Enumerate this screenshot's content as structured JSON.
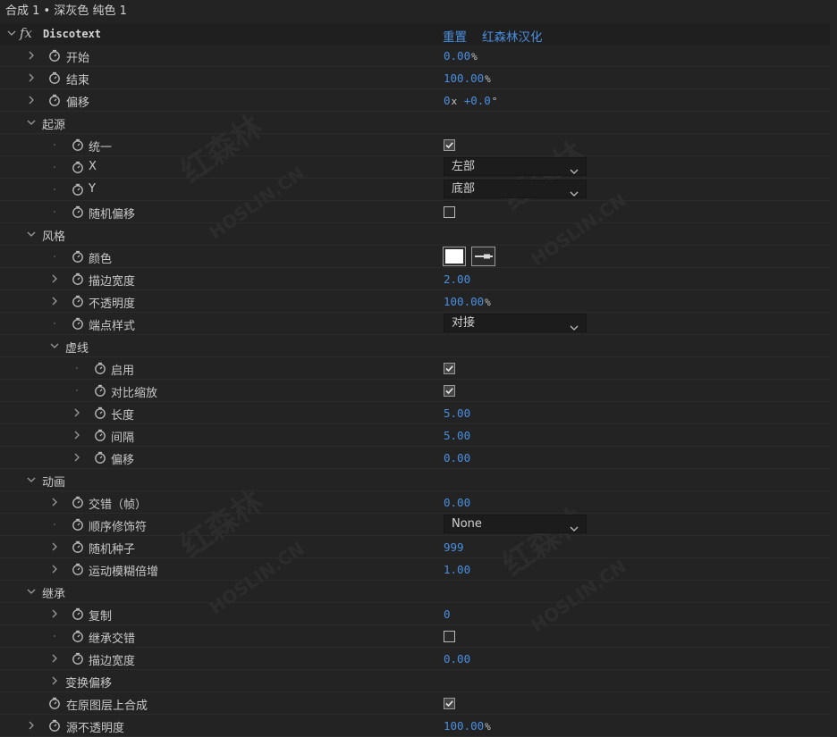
{
  "header": {
    "title": "合成 1 • 深灰色 纯色 1"
  },
  "effect": {
    "name": "Discotext",
    "reset_label": "重置",
    "about_label": "红森林汉化"
  },
  "watermark": {
    "cn": "红森林",
    "en": "HOSLIN.CN"
  },
  "colors": {
    "accent": "#4a8fe0",
    "bg": "#232323",
    "swatch": "#ffffff"
  },
  "rows": [
    {
      "indent": 0,
      "expander": "collapsed",
      "stopwatch": true,
      "label": "开始",
      "control": "number",
      "value": "0.00",
      "unit": "%"
    },
    {
      "indent": 0,
      "expander": "collapsed",
      "stopwatch": true,
      "label": "结束",
      "control": "number",
      "value": "100.00",
      "unit": "%"
    },
    {
      "indent": 0,
      "expander": "collapsed",
      "stopwatch": true,
      "label": "偏移",
      "control": "angle",
      "value": "0",
      "unit": "x",
      "value2": "+0.0",
      "unit2": "°"
    },
    {
      "indent": 0,
      "expander": "expanded",
      "stopwatch": false,
      "label": "起源",
      "control": "none"
    },
    {
      "indent": 1,
      "expander": "none",
      "stopwatch": true,
      "label": "统一",
      "control": "checkbox",
      "checked": true
    },
    {
      "indent": 1,
      "expander": "none",
      "stopwatch": true,
      "label": "X",
      "control": "select",
      "value": "左部"
    },
    {
      "indent": 1,
      "expander": "none",
      "stopwatch": true,
      "label": "Y",
      "control": "select",
      "value": "底部"
    },
    {
      "indent": 1,
      "expander": "none",
      "stopwatch": true,
      "label": "随机偏移",
      "control": "checkbox",
      "checked": false
    },
    {
      "indent": 0,
      "expander": "expanded",
      "stopwatch": false,
      "label": "风格",
      "control": "none"
    },
    {
      "indent": 1,
      "expander": "none",
      "stopwatch": true,
      "label": "颜色",
      "control": "color"
    },
    {
      "indent": 1,
      "expander": "collapsed",
      "stopwatch": true,
      "label": "描边宽度",
      "control": "number",
      "value": "2.00",
      "unit": ""
    },
    {
      "indent": 1,
      "expander": "collapsed",
      "stopwatch": true,
      "label": "不透明度",
      "control": "number",
      "value": "100.00",
      "unit": "%"
    },
    {
      "indent": 1,
      "expander": "none",
      "stopwatch": true,
      "label": "端点样式",
      "control": "select",
      "value": "对接"
    },
    {
      "indent": 1,
      "expander": "expanded",
      "stopwatch": false,
      "label": "虚线",
      "control": "none"
    },
    {
      "indent": 2,
      "expander": "none",
      "stopwatch": true,
      "label": "启用",
      "control": "checkbox",
      "checked": true
    },
    {
      "indent": 2,
      "expander": "none",
      "stopwatch": true,
      "label": "对比缩放",
      "control": "checkbox",
      "checked": true
    },
    {
      "indent": 2,
      "expander": "collapsed",
      "stopwatch": true,
      "label": "长度",
      "control": "number",
      "value": "5.00",
      "unit": ""
    },
    {
      "indent": 2,
      "expander": "collapsed",
      "stopwatch": true,
      "label": "间隔",
      "control": "number",
      "value": "5.00",
      "unit": ""
    },
    {
      "indent": 2,
      "expander": "collapsed",
      "stopwatch": true,
      "label": "偏移",
      "control": "number",
      "value": "0.00",
      "unit": ""
    },
    {
      "indent": 0,
      "expander": "expanded",
      "stopwatch": false,
      "label": "动画",
      "control": "none"
    },
    {
      "indent": 1,
      "expander": "collapsed",
      "stopwatch": true,
      "label": "交错（帧）",
      "control": "number",
      "value": "0.00",
      "unit": ""
    },
    {
      "indent": 1,
      "expander": "none",
      "stopwatch": true,
      "label": "顺序修饰符",
      "control": "select",
      "value": "None"
    },
    {
      "indent": 1,
      "expander": "collapsed",
      "stopwatch": true,
      "label": "随机种子",
      "control": "number",
      "value": "999",
      "unit": ""
    },
    {
      "indent": 1,
      "expander": "collapsed",
      "stopwatch": true,
      "label": "运动模糊倍增",
      "control": "number",
      "value": "1.00",
      "unit": ""
    },
    {
      "indent": 0,
      "expander": "expanded",
      "stopwatch": false,
      "label": "继承",
      "control": "none"
    },
    {
      "indent": 1,
      "expander": "collapsed",
      "stopwatch": true,
      "label": "复制",
      "control": "number",
      "value": "0",
      "unit": ""
    },
    {
      "indent": 1,
      "expander": "none",
      "stopwatch": true,
      "label": "继承交错",
      "control": "checkbox",
      "checked": false
    },
    {
      "indent": 1,
      "expander": "collapsed",
      "stopwatch": true,
      "label": "描边宽度",
      "control": "number",
      "value": "0.00",
      "unit": ""
    },
    {
      "indent": 1,
      "expander": "collapsed",
      "stopwatch": false,
      "label": "变换偏移",
      "control": "none"
    },
    {
      "indent": 0,
      "expander": "none",
      "stopwatch": true,
      "label": "在原图层上合成",
      "control": "checkbox",
      "checked": true
    },
    {
      "indent": 0,
      "expander": "collapsed",
      "stopwatch": true,
      "label": "源不透明度",
      "control": "number",
      "value": "100.00",
      "unit": "%"
    }
  ]
}
